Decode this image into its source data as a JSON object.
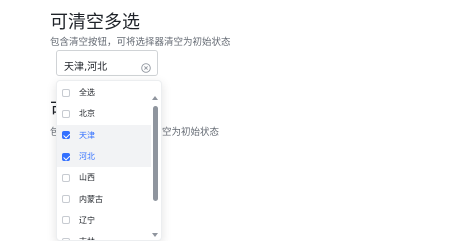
{
  "section": {
    "title": "可清空多选",
    "description": "包含清空按钮，可将选择器清空为初始状态"
  },
  "select": {
    "value": "天津,河北",
    "clear_icon": "close-circle-icon",
    "options": [
      {
        "label": "全选",
        "checked": false
      },
      {
        "label": "北京",
        "checked": false
      },
      {
        "label": "天津",
        "checked": true
      },
      {
        "label": "河北",
        "checked": true
      },
      {
        "label": "山西",
        "checked": false
      },
      {
        "label": "内蒙古",
        "checked": false
      },
      {
        "label": "辽宁",
        "checked": false
      },
      {
        "label": "吉林",
        "checked": false
      }
    ]
  },
  "next_section": {
    "title_partial": "可",
    "desc_left_partial": "包",
    "desc_right_partial": "空为初始状态"
  },
  "colors": {
    "accent": "#3370ff",
    "selected_bg": "#f2f3f5"
  }
}
